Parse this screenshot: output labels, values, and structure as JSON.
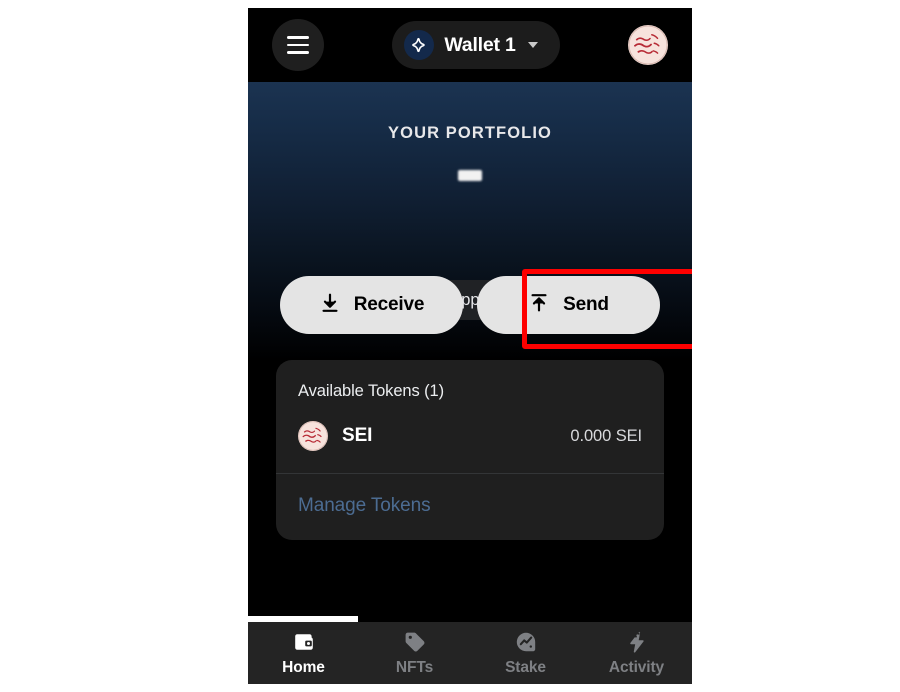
{
  "app": {
    "theme_bg": "#000000",
    "hero_gradient_top": "#1b3351",
    "hero_gradient_bottom": "#000000",
    "accent_link": "#4c6c92",
    "highlight_color": "#fe0000"
  },
  "appbar": {
    "menu_icon": "hamburger-menu-icon",
    "wallet_icon": "wallet-diamond-icon",
    "wallet_name": "Wallet 1",
    "wallet_dropdown_icon": "chevron-down-icon",
    "avatar_icon": "sei-logo-avatar"
  },
  "hero": {
    "title": "YOUR PORTFOLIO",
    "balance_value": "",
    "balance_hidden": true,
    "address": "sei19...63qpp",
    "copy_icon": "copy-icon",
    "hide_balance_icon": "eye-off-icon"
  },
  "actions": [
    {
      "label": "Receive",
      "icon": "download-arrow-icon",
      "highlighted": true
    },
    {
      "label": "Send",
      "icon": "upload-arrow-icon",
      "highlighted": false
    }
  ],
  "tokens_card": {
    "header": "Available Tokens (1)",
    "rows": [
      {
        "logo": "sei-token-logo",
        "symbol": "SEI",
        "amount": "0.000 SEI"
      }
    ],
    "manage_link": "Manage Tokens"
  },
  "bottom_nav": {
    "items": [
      {
        "label": "Home",
        "icon": "wallet-icon",
        "active": true
      },
      {
        "label": "NFTs",
        "icon": "tag-icon",
        "active": false
      },
      {
        "label": "Stake",
        "icon": "chart-trend-icon",
        "active": false
      },
      {
        "label": "Activity",
        "icon": "lightning-bolt-icon",
        "active": false
      }
    ]
  }
}
